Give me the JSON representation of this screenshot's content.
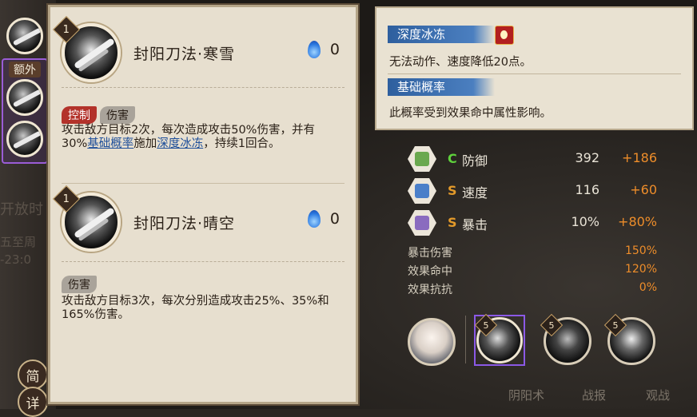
{
  "left_panel": {
    "extra_label": "额外",
    "btn_simple": "简",
    "btn_detail": "详",
    "ghost_texts": [
      "开放时",
      "五至周",
      "-23:0"
    ]
  },
  "skills": [
    {
      "level": "1",
      "name": "封阳刀法·寒雪",
      "cost": "0",
      "tags": [
        "控制",
        "伤害"
      ],
      "desc_parts": {
        "p1": "攻击敌方目标2次，每次造成攻击50%伤害，并有30%",
        "kw1": "基础概率",
        "p2": "施加",
        "kw2": "深度冰冻",
        "p3": "，持续1回合。"
      }
    },
    {
      "level": "1",
      "name": "封阳刀法·晴空",
      "cost": "0",
      "tags": [
        "伤害"
      ],
      "desc": "攻击敌方目标3次，每次分别造成攻击25%、35%和165%伤害。"
    }
  ],
  "tooltip": {
    "items": [
      {
        "title": "深度冰冻",
        "text": "无法动作、速度降低20点。"
      },
      {
        "title": "基础概率",
        "text": "此概率受到效果命中属性影响。"
      }
    ]
  },
  "stats": [
    {
      "label": "防御",
      "value": "392",
      "bonus": "+186",
      "icon_color": "#6aa84f",
      "arrow": "green"
    },
    {
      "label": "速度",
      "value": "116",
      "bonus": "+60",
      "icon_color": "#4a7fc9",
      "arrow": "orange"
    },
    {
      "label": "暴击",
      "value": "10%",
      "bonus": "+80%",
      "icon_color": "#8a6bbf",
      "arrow": "orange"
    }
  ],
  "sub_stats": [
    {
      "label": "暴击伤害",
      "value": "150%"
    },
    {
      "label": "效果命中",
      "value": "120%"
    },
    {
      "label": "效果抗抗",
      "value": "0%"
    }
  ],
  "portraits": [
    {
      "level": ""
    },
    {
      "level": "5"
    },
    {
      "level": "5"
    },
    {
      "level": "5"
    }
  ],
  "bottom_tabs": [
    "阴阳术",
    "战报",
    "观战"
  ],
  "colors": {
    "panel_bg": "#e7dfcf",
    "keyword": "#1f4f9a",
    "bonus": "#ee8d2a",
    "selected_frame": "#8b59e6"
  }
}
